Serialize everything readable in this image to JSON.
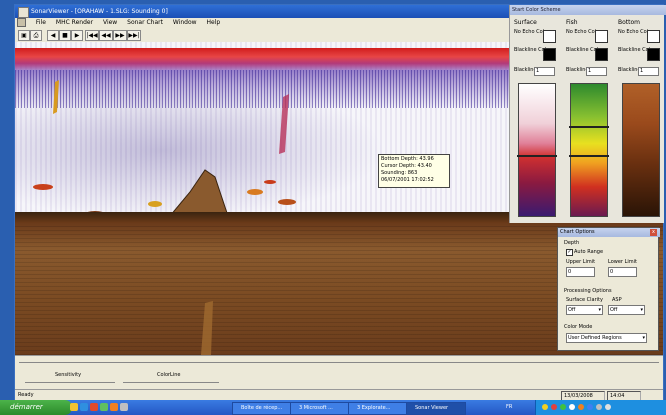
{
  "window": {
    "title": "SonarViewer - [ORAHAW - 1.SLG: Sounding 0]"
  },
  "menu": [
    "File",
    "MHC Render",
    "View",
    "Sonar Chart",
    "Window",
    "Help"
  ],
  "toolbar": {
    "buttons": [
      "◀",
      "■",
      "▶",
      "|◀◀",
      "◀◀",
      "▶▶",
      "▶▶|"
    ]
  },
  "infobox": {
    "bottom_depth": "Bottom Depth: 43.96",
    "cursor_depth": "Cursor Depth: 43.40",
    "sounding": "Sounding: 863",
    "timestamp": "06/07/2001 17:02:52"
  },
  "color_panel": {
    "title": "Start Color Scheme",
    "columns": [
      {
        "name": "Surface",
        "no_echo": "No Echo Color",
        "blackline": "Blackline Color",
        "width_label": "Blackline Width",
        "width_value": "1",
        "swatch_noecho": "#ffffff",
        "swatch_blackline": "#000000"
      },
      {
        "name": "Fish",
        "no_echo": "No Echo Color",
        "blackline": "Blackline Color",
        "width_label": "Blackline Width",
        "width_value": "1",
        "swatch_noecho": "#ffffff",
        "swatch_blackline": "#000000"
      },
      {
        "name": "Bottom",
        "no_echo": "No Echo Color",
        "blackline": "Blackline Color",
        "width_label": "Blackline Width",
        "width_value": "1",
        "swatch_noecho": "#ffffff",
        "swatch_blackline": "#000000"
      }
    ]
  },
  "chart_options": {
    "title": "Chart Options",
    "depth_label": "Depth",
    "auto_range": "Auto Range",
    "upper_limit": "Upper Limit",
    "lower_limit": "Lower Limit",
    "upper_value": "0",
    "lower_value": "0",
    "processing_label": "Processing Options",
    "surface_clarity": "Surface Clarity",
    "asp": "ASP",
    "surface_value": "Off",
    "asp_value": "Off",
    "color_mode_label": "Color Mode",
    "color_mode_value": "User Defined Regions"
  },
  "sliders": {
    "sensitivity": "Sensitivity",
    "colorline": "ColorLine"
  },
  "status": {
    "left": "Ready",
    "date": "13/03/2008",
    "time": "14:04"
  },
  "taskbar": {
    "start": "démarrer",
    "tasks": [
      "Boîte de récep...",
      "3 Microsoft ...",
      "3 Explorate...",
      "Sonar Viewer"
    ],
    "tray_label": "FR"
  }
}
